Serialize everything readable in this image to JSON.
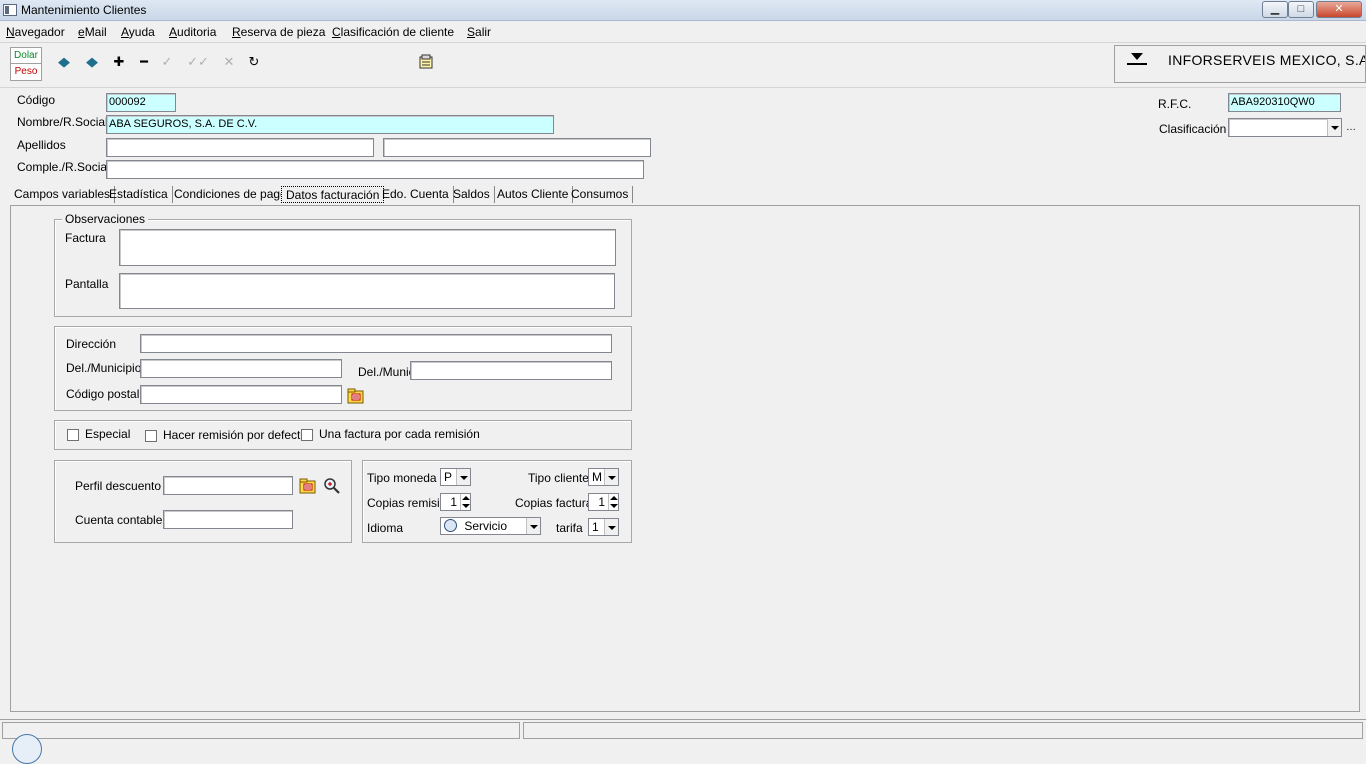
{
  "window": {
    "title": "Mantenimiento Clientes",
    "min_glyph": "▁",
    "max_glyph": "□",
    "close_glyph": "✕"
  },
  "menu": [
    "Navegador",
    "eMail",
    "Ayuda",
    "Auditoria",
    "Reserva de pieza",
    "Clasificación de cliente",
    "Salir"
  ],
  "toolbar": {
    "currency_top": "Dolar",
    "currency_bottom": "Peso",
    "icons": {
      "prev": "◆",
      "next": "◆",
      "add": "✚",
      "remove": "━",
      "confirm": "✓",
      "confirm_all": "✓✓",
      "cancel": "✕",
      "refresh": "↻"
    },
    "company_name": "INFORSERVEIS MEXICO, S.A"
  },
  "header": {
    "codigo_label": "Código",
    "codigo_value": "000092",
    "nombre_label": "Nombre/R.Social",
    "nombre_value": "ABA SEGUROS, S.A. DE C.V.",
    "apellidos_label": "Apellidos",
    "apellido1_value": "",
    "apellido2_value": "",
    "comple_label": "Comple./R.Social",
    "comple_value": "",
    "rfc_label": "R.F.C.",
    "rfc_value": "ABA920310QW0",
    "clasificacion_label": "Clasificación",
    "clasificacion_value": ""
  },
  "tabs": [
    "Campos variables",
    "Estadística",
    "Condiciones de pago",
    "Datos facturación",
    "Edo. Cuenta",
    "Saldos",
    "Autos Cliente",
    "Consumos"
  ],
  "active_tab": "Datos facturación",
  "observaciones": {
    "title": "Observaciones",
    "factura_label": "Factura",
    "pantalla_label": "Pantalla"
  },
  "direccion": {
    "direccion_label": "Dirección",
    "municipio_label": "Del./Municipio",
    "munic2_label": "Del./Munic",
    "cp_label": "Código postal"
  },
  "options": {
    "especial": "Especial",
    "hacer_remision": "Hacer remisión por defecto",
    "una_factura": "Una factura por cada remisión"
  },
  "descuento": {
    "perfil_label": "Perfil descuento",
    "cuenta_label": "Cuenta contable"
  },
  "billing": {
    "tipo_moneda_label": "Tipo moneda",
    "tipo_moneda_value": "P",
    "tipo_cliente_label": "Tipo cliente",
    "tipo_cliente_value": "M",
    "copias_remision_label": "Copias remisión",
    "copias_remision_value": "1",
    "copias_factura_label": "Copias factura",
    "copias_factura_value": "1",
    "idioma_label": "Idioma",
    "idioma_value": "Servicio",
    "tarifa_label": "tarifa",
    "tarifa_value": "1"
  },
  "colors": {
    "highlight_field": "#ccffff",
    "currency_top": "#0a8a2a",
    "currency_bottom": "#c00000",
    "toolbar_arrows": "#1f6e8c"
  }
}
